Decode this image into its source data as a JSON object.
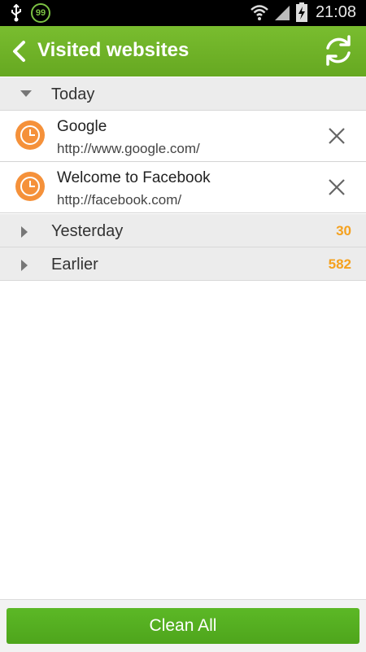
{
  "status_bar": {
    "battery_badge": "99",
    "time": "21:08",
    "icons": [
      "usb-icon",
      "battery-badge",
      "wifi-icon",
      "signal-icon",
      "battery-charging-icon"
    ]
  },
  "app_bar": {
    "title": "Visited websites",
    "back_icon": "chevron-left-icon",
    "refresh_icon": "refresh-icon",
    "background": "#6fb32a"
  },
  "sections": {
    "today": {
      "label": "Today",
      "expanded": true
    },
    "yesterday": {
      "label": "Yesterday",
      "count": "30",
      "expanded": false
    },
    "earlier": {
      "label": "Earlier",
      "count": "582",
      "expanded": false
    }
  },
  "items": [
    {
      "title": "Google",
      "url": "http://www.google.com/",
      "icon": "clock-icon"
    },
    {
      "title": "Welcome to Facebook",
      "url": "http://facebook.com/",
      "icon": "clock-icon"
    }
  ],
  "footer": {
    "clean_label": "Clean All"
  },
  "colors": {
    "accent_green": "#5cb826",
    "count_orange": "#f5a11e",
    "clock_orange": "#f5913a"
  }
}
